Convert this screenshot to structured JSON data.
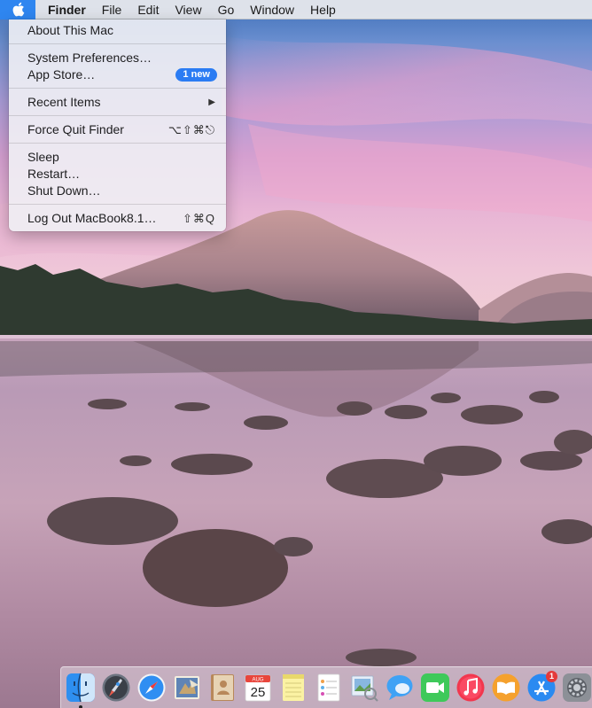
{
  "menubar": {
    "apple_icon": "apple-logo-icon",
    "items": [
      "Finder",
      "File",
      "Edit",
      "View",
      "Go",
      "Window",
      "Help"
    ]
  },
  "apple_menu": {
    "about": "About This Mac",
    "system_preferences": "System Preferences…",
    "app_store": "App Store…",
    "app_store_badge": "1 new",
    "recent_items": "Recent Items",
    "force_quit": "Force Quit Finder",
    "force_quit_shortcut": "⌥⇧⌘⎋",
    "sleep": "Sleep",
    "restart": "Restart…",
    "shut_down": "Shut Down…",
    "log_out": "Log Out MacBook8.1…",
    "log_out_shortcut": "⇧⌘Q"
  },
  "dock": {
    "calendar_month": "AUG",
    "calendar_day": "25",
    "app_store_badge": "1",
    "icons": [
      "finder-icon",
      "launchpad-icon",
      "safari-icon",
      "mail-icon",
      "contacts-icon",
      "calendar-icon",
      "notes-icon",
      "reminders-icon",
      "preview-icon",
      "messages-icon",
      "facetime-icon",
      "itunes-icon",
      "ibooks-icon",
      "app-store-icon",
      "system-preferences-icon"
    ]
  },
  "colors": {
    "menu_highlight": "#2f86f0",
    "badge_blue": "#2b7cf3",
    "notification_red": "#e43a3a"
  }
}
